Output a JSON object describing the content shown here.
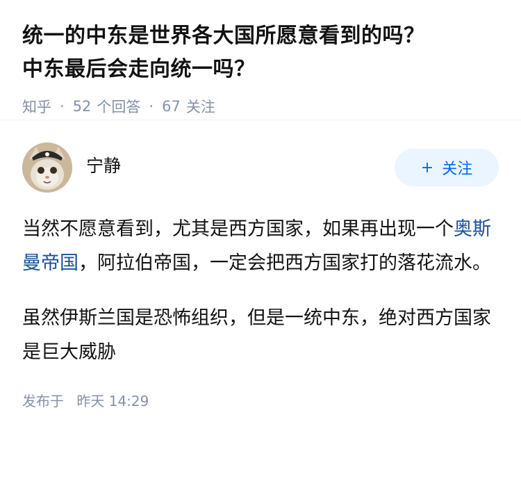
{
  "question": {
    "title_line1": "统一的中东是世界各大国所愿意看到的吗？",
    "title_line2": "中东最后会走向统一吗？",
    "source": "知乎",
    "answers_count": "52",
    "answers_label": "个回答",
    "follows_count": "67",
    "follows_label": "关注"
  },
  "answer": {
    "author_name": "宁静",
    "follow_button": {
      "icon": "+",
      "label": "关注"
    },
    "paragraph1": {
      "before": "当然不愿意看到，尤其是西方国家，如果再出现一个",
      "link": "奥斯曼帝国",
      "after": "，阿拉伯帝国，一定会把西方国家打的落花流水。"
    },
    "paragraph2": "虽然伊斯兰国是恐怖组织，但是一统中东，绝对西方国家是巨大威胁",
    "publish": {
      "label": "发布于",
      "time": "昨天 14:29"
    }
  },
  "colors": {
    "meta_gray": "#8590a6",
    "link_blue": "#175199",
    "follow_blue": "#0066ff",
    "follow_bg": "#ebf5ff"
  }
}
